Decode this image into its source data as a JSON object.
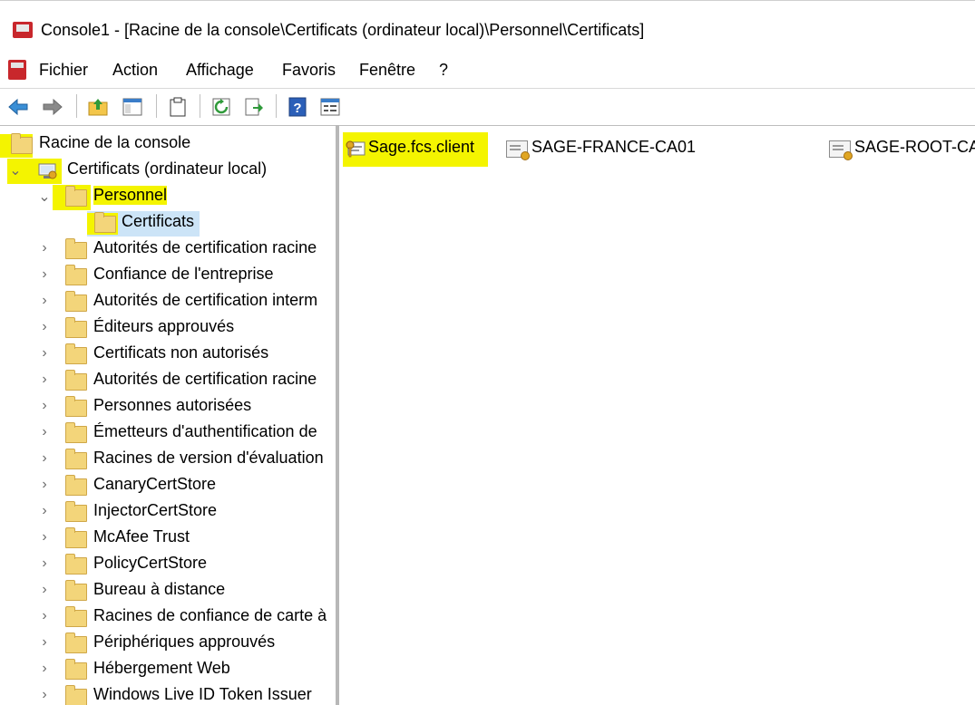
{
  "window": {
    "title": "Console1 - [Racine de la console\\Certificats (ordinateur local)\\Personnel\\Certificats]"
  },
  "menu": [
    "Fichier",
    "Action",
    "Affichage",
    "Favoris",
    "Fenêtre",
    "?"
  ],
  "toolbar": {
    "icons": [
      "back-arrow-icon",
      "forward-arrow-icon",
      "up-folder-icon",
      "show-hide-tree-icon",
      "clipboard-icon",
      "refresh-icon",
      "export-list-icon",
      "help-icon",
      "properties-icon"
    ]
  },
  "tree": {
    "root": "Racine de la console",
    "computer": "Certificats (ordinateur local)",
    "personal": "Personnel",
    "certificates": "Certificats",
    "stores": [
      "Autorités de certification racine",
      "Confiance de l'entreprise",
      "Autorités de certification interm",
      "Éditeurs approuvés",
      "Certificats non autorisés",
      "Autorités de certification racine",
      "Personnes autorisées",
      "Émetteurs d'authentification de",
      "Racines de version d'évaluation",
      "CanaryCertStore",
      "InjectorCertStore",
      "McAfee Trust",
      "PolicyCertStore",
      "Bureau à distance",
      "Racines de confiance de carte à",
      "Périphériques approuvés",
      "Hébergement Web",
      "Windows Live ID Token Issuer"
    ]
  },
  "certificates": [
    "Sage.fcs.client",
    "SAGE-FRANCE-CA01",
    "SAGE-ROOT-CA"
  ],
  "colors": {
    "highlight": "#f4f400",
    "selection": "#cce4f7",
    "folder": "#f3d57a"
  }
}
